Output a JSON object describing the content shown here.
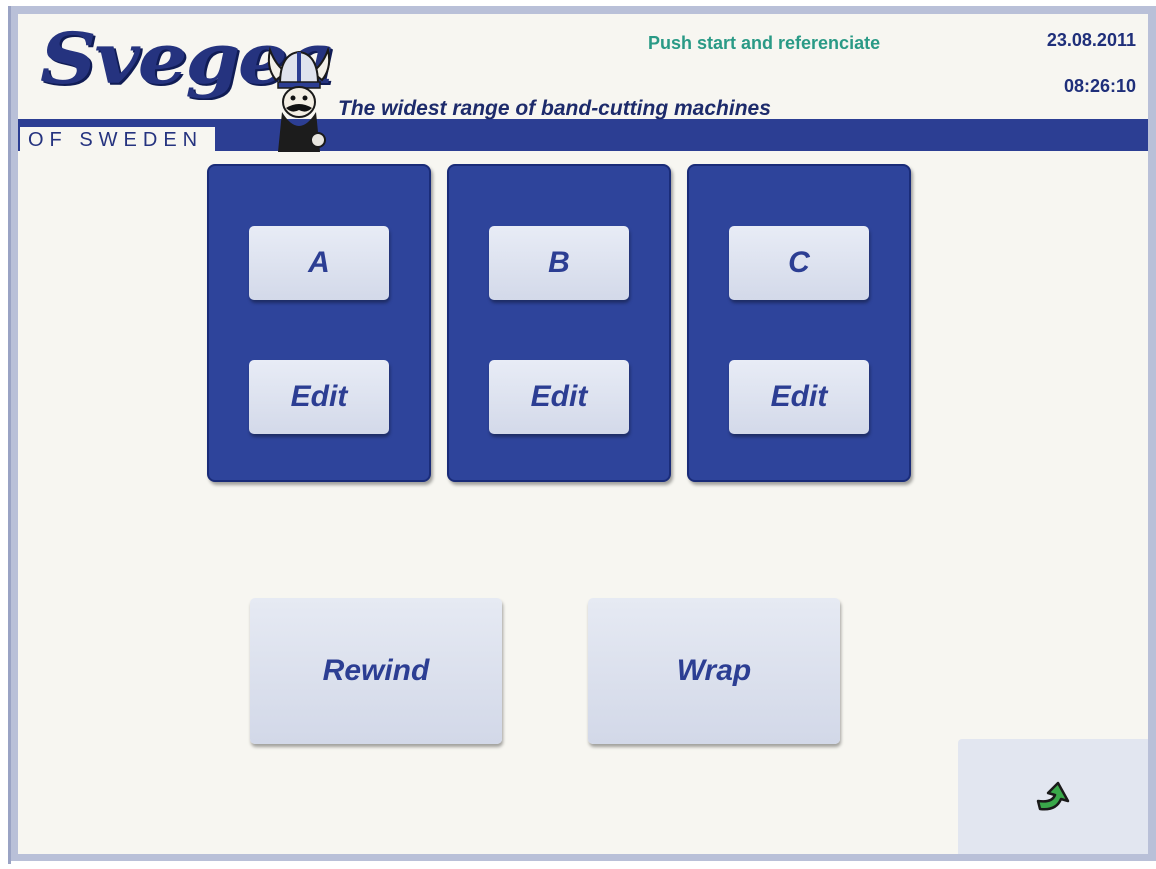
{
  "header": {
    "brand": "Svegea",
    "brand_sub": "OF SWEDEN",
    "tagline": "The widest range of band-cutting machines",
    "status_message": "Push start and referenciate",
    "date": "23.08.2011",
    "time": "08:26:10"
  },
  "programs": [
    {
      "select_label": "A",
      "edit_label": "Edit"
    },
    {
      "select_label": "B",
      "edit_label": "Edit"
    },
    {
      "select_label": "C",
      "edit_label": "Edit"
    }
  ],
  "actions": {
    "rewind_label": "Rewind",
    "wrap_label": "Wrap"
  },
  "icons": {
    "next": "next-arrow-icon",
    "mascot": "viking-mascot-icon"
  },
  "colors": {
    "panel": "#2e449b",
    "header_band": "#2c3e93",
    "status_text": "#2a9a86",
    "button_face": "#dde2ef",
    "arrow": "#3aa84a"
  }
}
